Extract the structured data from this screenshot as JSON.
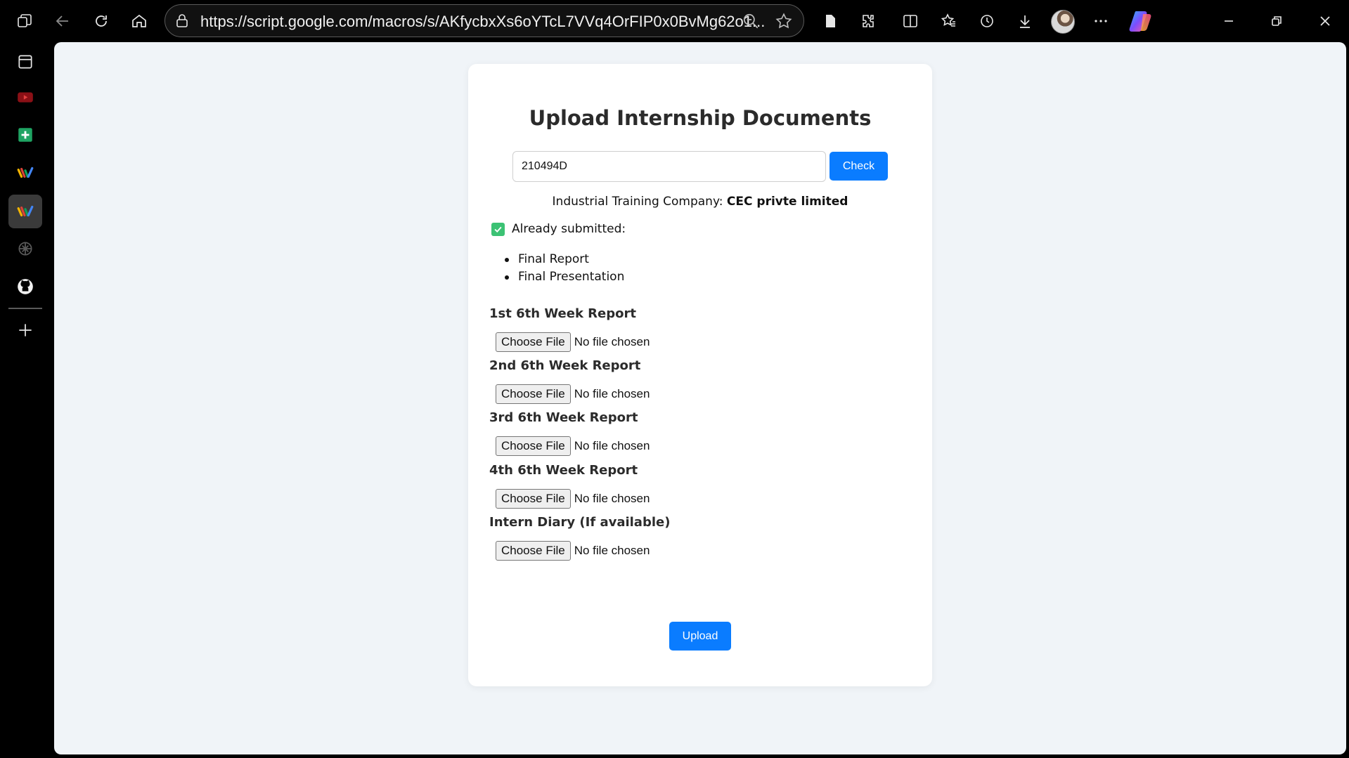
{
  "browser": {
    "url": "https://script.google.com/macros/s/AKfycbxXs6oYTcL7VVq4OrFIP0x0BvMg62o1..."
  },
  "form": {
    "title": "Upload Internship Documents",
    "id_value": "210494D",
    "check_label": "Check",
    "company_prefix": "Industrial Training Company:",
    "company_name": "CEC privte limited",
    "submitted_label": "Already submitted:",
    "submitted_items": [
      "Final Report",
      "Final Presentation"
    ],
    "sections": [
      {
        "label": "1st 6th Week Report",
        "button": "Choose File",
        "status": "No file chosen"
      },
      {
        "label": "2nd 6th Week Report",
        "button": "Choose File",
        "status": "No file chosen"
      },
      {
        "label": "3rd 6th Week Report",
        "button": "Choose File",
        "status": "No file chosen"
      },
      {
        "label": "4th 6th Week Report",
        "button": "Choose File",
        "status": "No file chosen"
      },
      {
        "label": "Intern Diary (If available)",
        "button": "Choose File",
        "status": "No file chosen"
      }
    ],
    "upload_label": "Upload"
  },
  "colors": {
    "primary": "#0a7cff",
    "page_bg": "#f0f4f8",
    "check_green": "#3cc274"
  }
}
